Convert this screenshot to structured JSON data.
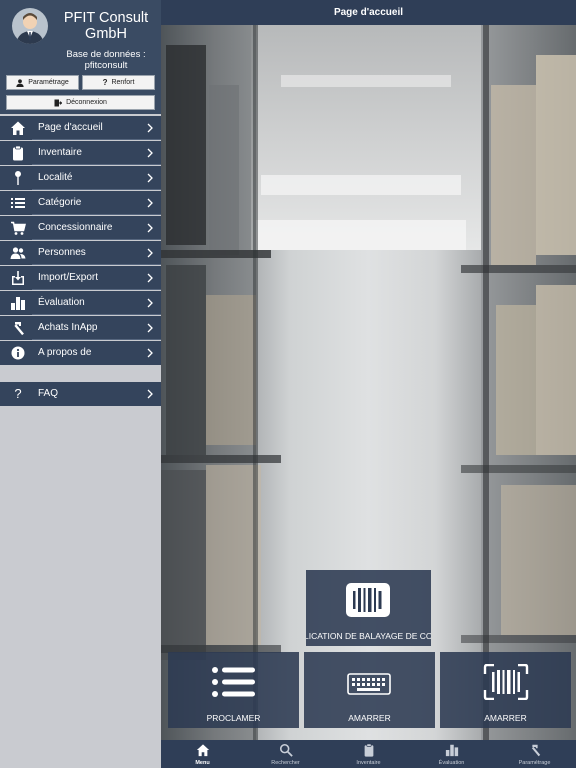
{
  "sidebar": {
    "company": "PFIT Consult GmbH",
    "database_line1": "Base de données :",
    "database_line2": "pfitconsult",
    "buttons": {
      "settings": "Paramétrage",
      "reinforce": "Renfort",
      "logout": "Déconnexion"
    },
    "items": [
      {
        "label": "Page d'accueil",
        "icon": "home-icon"
      },
      {
        "label": "Inventaire",
        "icon": "clipboard-icon"
      },
      {
        "label": "Localité",
        "icon": "pin-icon"
      },
      {
        "label": "Catégorie",
        "icon": "list-icon"
      },
      {
        "label": "Concessionnaire",
        "icon": "cart-icon"
      },
      {
        "label": "Personnes",
        "icon": "people-icon"
      },
      {
        "label": "Import/Export",
        "icon": "download-icon"
      },
      {
        "label": "Évaluation",
        "icon": "bar-chart-icon"
      },
      {
        "label": "Achats InApp",
        "icon": "hammer-icon"
      },
      {
        "label": "A propos de",
        "icon": "info-icon"
      }
    ],
    "faq": {
      "label": "FAQ",
      "icon": "question-icon"
    }
  },
  "header": {
    "title": "Page d'accueil"
  },
  "tiles": {
    "scan_app": "APPLICATION DE BALAYAGE DE CODES",
    "proclaim": "PROCLAMER",
    "moor_keyboard": "AMARRER",
    "moor_barcode": "AMARRER"
  },
  "bottom_nav": [
    {
      "label": "Menu",
      "icon": "home-icon",
      "active": true
    },
    {
      "label": "Rechercher",
      "icon": "search-icon",
      "active": false
    },
    {
      "label": "Inventaire",
      "icon": "clipboard-icon",
      "active": false
    },
    {
      "label": "Évaluation",
      "icon": "bar-chart-icon",
      "active": false
    },
    {
      "label": "Paramétrage",
      "icon": "hammer-icon",
      "active": false
    }
  ],
  "colors": {
    "sidebar_header": "#3a4b63",
    "menu_item": "#34445c",
    "bar": "#2f3e57",
    "sidebar_bg": "#c9cbd0"
  }
}
